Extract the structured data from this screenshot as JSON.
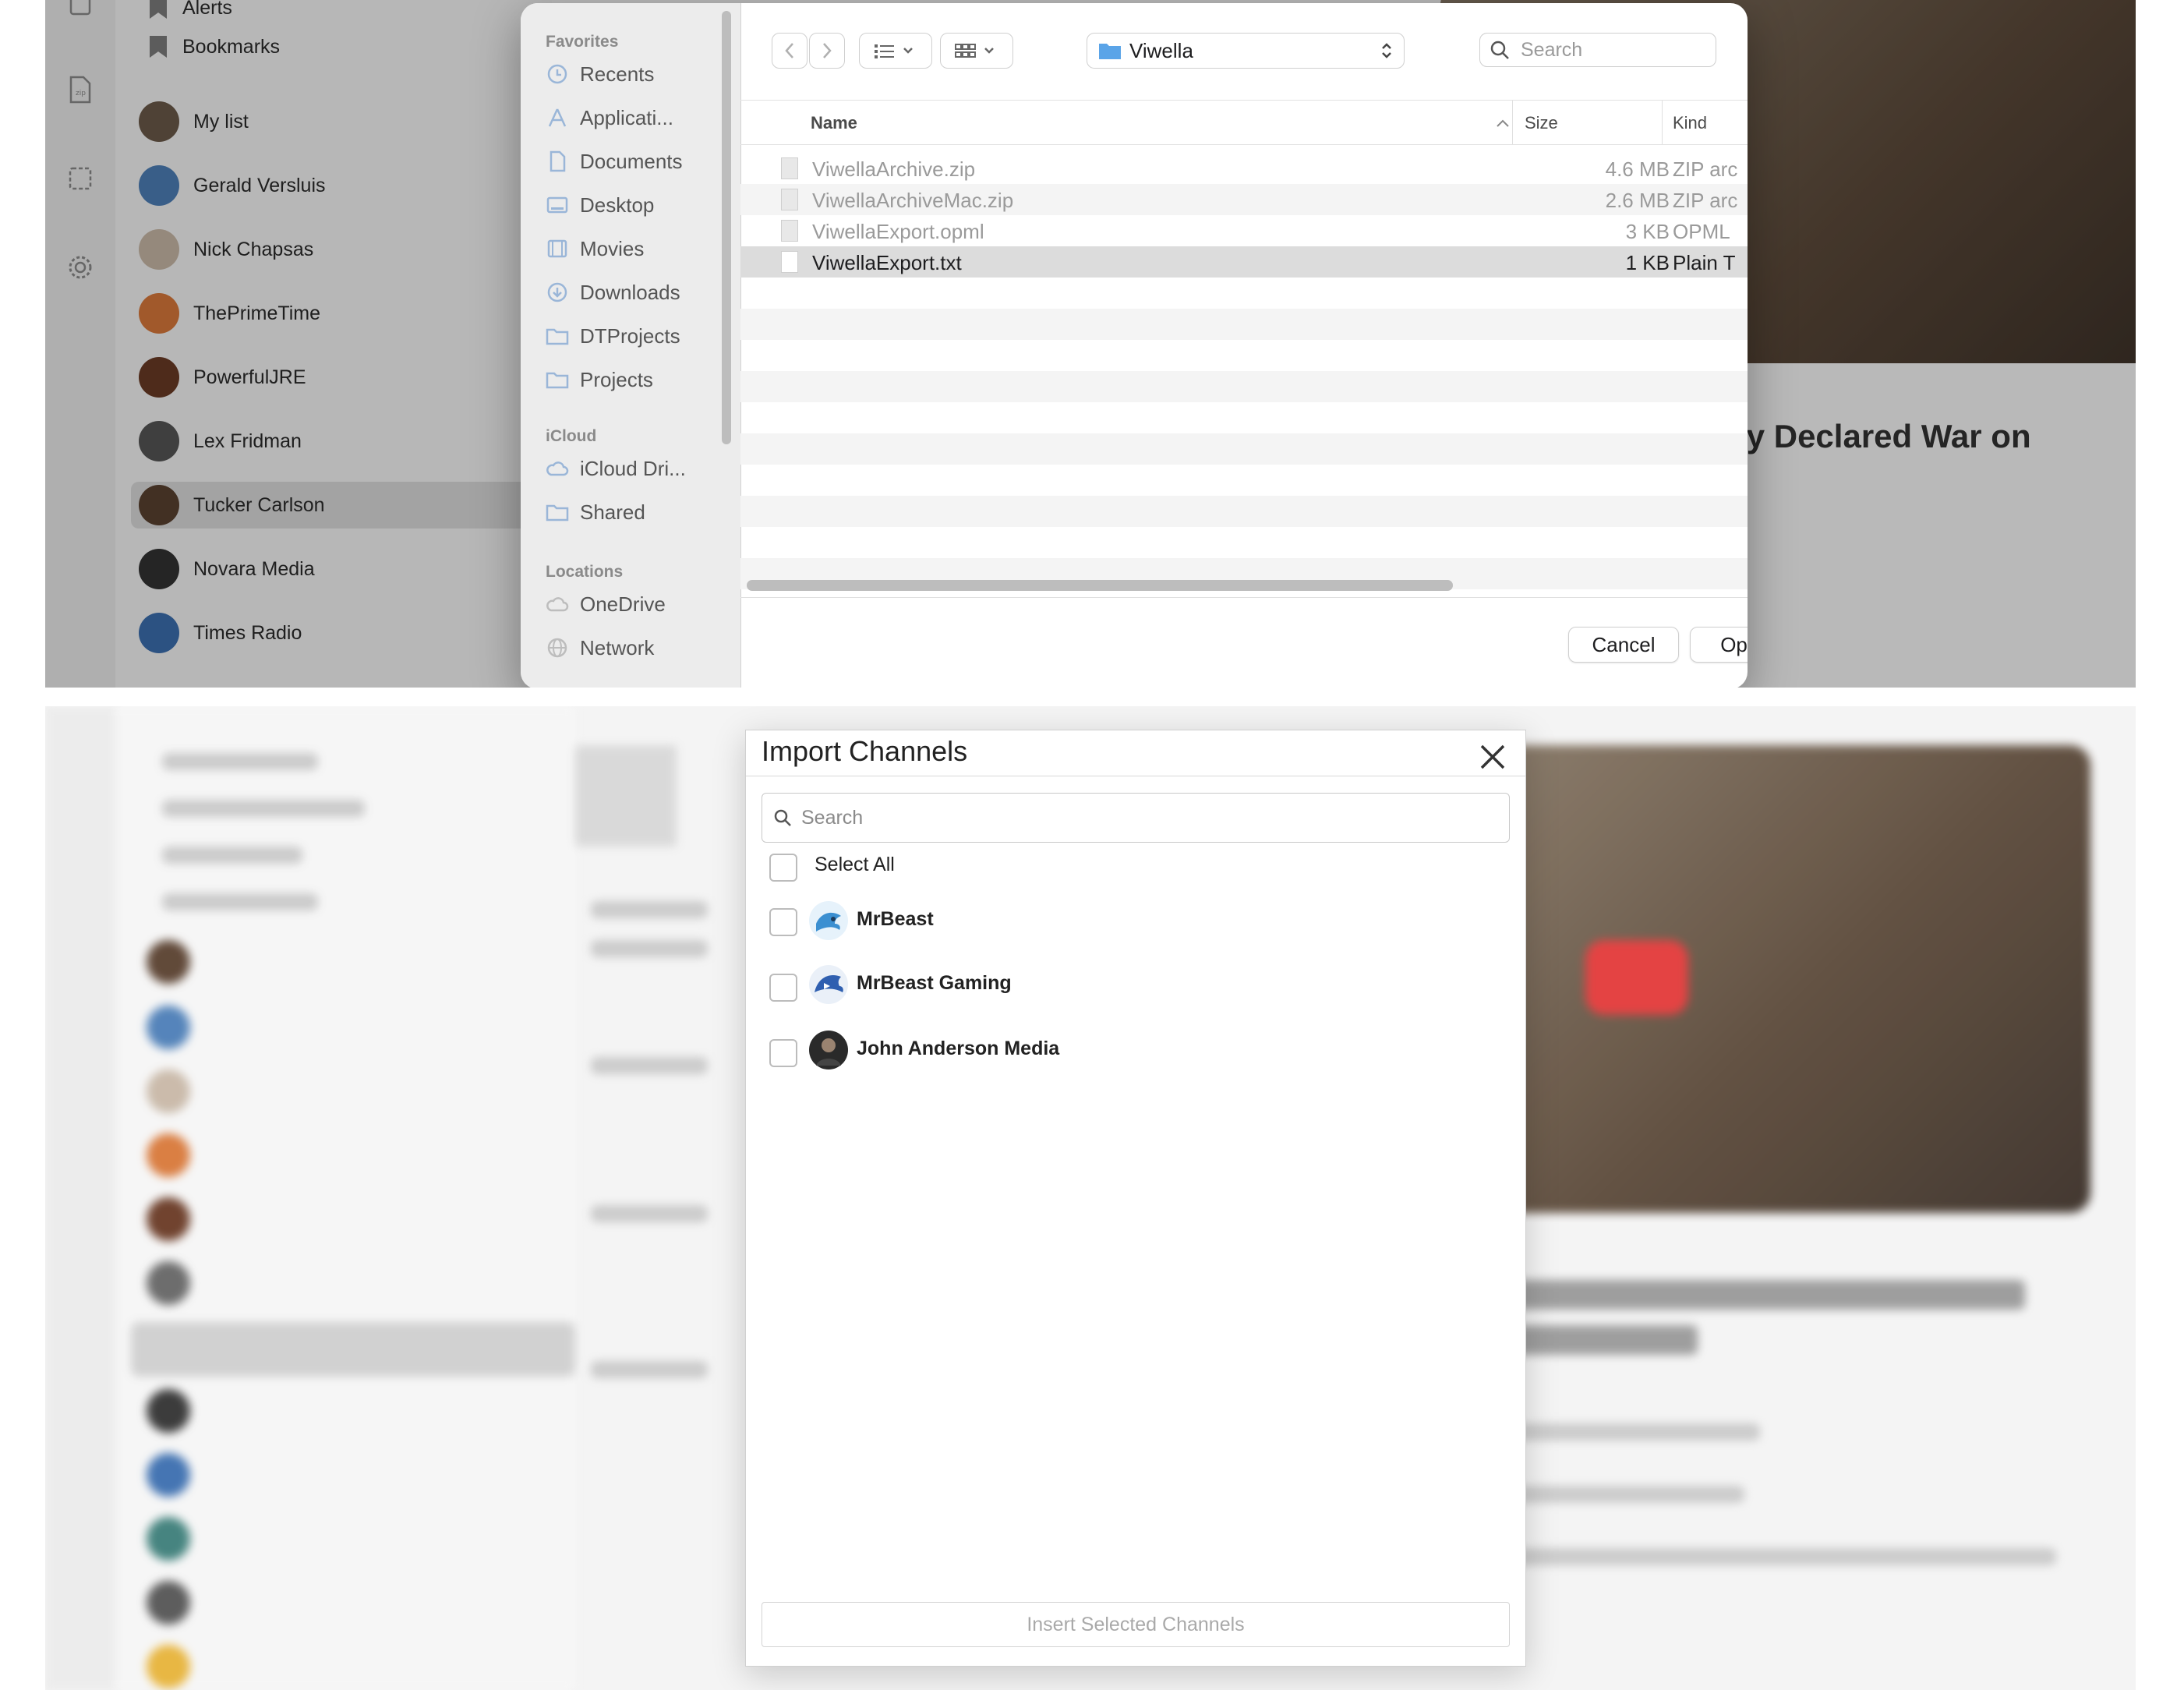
{
  "background_app": {
    "sidebar_top": {
      "alerts_label": "Alerts",
      "bookmarks_label": "Bookmarks"
    },
    "channels": [
      {
        "label": "My list"
      },
      {
        "label": "Gerald Versluis"
      },
      {
        "label": "Nick Chapsas"
      },
      {
        "label": "ThePrimeTime"
      },
      {
        "label": "PowerfulJRE"
      },
      {
        "label": "Lex Fridman"
      },
      {
        "label": "Tucker Carlson"
      },
      {
        "label": "Novara Media"
      },
      {
        "label": "Times Radio"
      }
    ],
    "headline_fragment": "sky Declared War on"
  },
  "file_dialog": {
    "sidebar": {
      "favorites_heading": "Favorites",
      "favorites": [
        {
          "label": "Recents",
          "icon": "clock-icon"
        },
        {
          "label": "Applicati...",
          "icon": "applications-icon"
        },
        {
          "label": "Documents",
          "icon": "document-icon"
        },
        {
          "label": "Desktop",
          "icon": "desktop-icon"
        },
        {
          "label": "Movies",
          "icon": "film-icon"
        },
        {
          "label": "Downloads",
          "icon": "download-icon"
        },
        {
          "label": "DTProjects",
          "icon": "folder-icon"
        },
        {
          "label": "Projects",
          "icon": "folder-icon"
        }
      ],
      "icloud_heading": "iCloud",
      "icloud": [
        {
          "label": "iCloud Dri...",
          "icon": "cloud-icon"
        },
        {
          "label": "Shared",
          "icon": "shared-folder-icon"
        }
      ],
      "locations_heading": "Locations",
      "locations": [
        {
          "label": "OneDrive",
          "icon": "cloud-icon"
        },
        {
          "label": "Network",
          "icon": "globe-icon"
        }
      ]
    },
    "toolbar": {
      "current_folder": "Viwella",
      "search_placeholder": "Search"
    },
    "columns": {
      "name": "Name",
      "size": "Size",
      "kind": "Kind"
    },
    "files": [
      {
        "name": "ViwellaArchive.zip",
        "size": "4.6 MB",
        "kind": "ZIP arc",
        "selected": false
      },
      {
        "name": "ViwellaArchiveMac.zip",
        "size": "2.6 MB",
        "kind": "ZIP arc",
        "selected": false
      },
      {
        "name": "ViwellaExport.opml",
        "size": "3 KB",
        "kind": "OPML",
        "selected": false
      },
      {
        "name": "ViwellaExport.txt",
        "size": "1 KB",
        "kind": "Plain T",
        "selected": true
      }
    ],
    "cancel_label": "Cancel",
    "open_label": "Open"
  },
  "import_dialog": {
    "title": "Import Channels",
    "search_placeholder": "Search",
    "select_all_label": "Select All",
    "channels": [
      {
        "name": "MrBeast",
        "checked": false
      },
      {
        "name": "MrBeast Gaming",
        "checked": false
      },
      {
        "name": "John Anderson Media",
        "checked": false
      }
    ],
    "insert_label": "Insert Selected Channels"
  },
  "colors": {
    "folder_blue": "#5aa4e8",
    "selection_gray": "#dcdcdc",
    "play_red": "#e43a3a"
  }
}
